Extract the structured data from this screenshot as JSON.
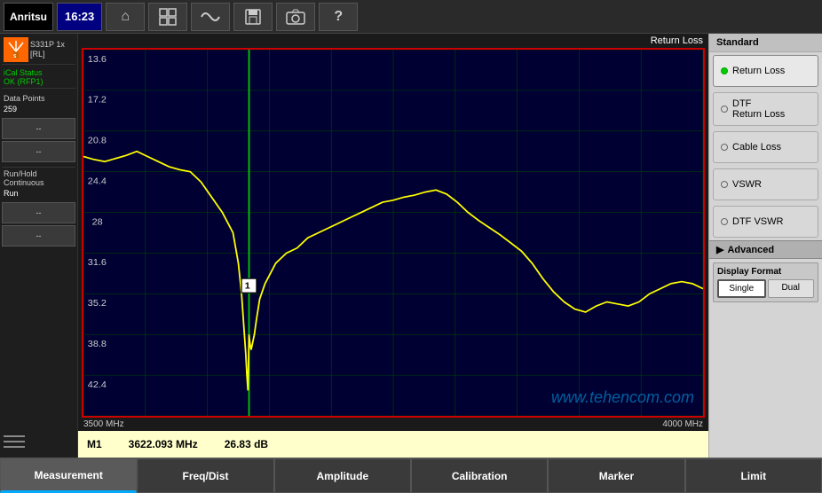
{
  "header": {
    "logo": "Anritsu",
    "time": "16:23",
    "icons": [
      {
        "name": "home-icon",
        "symbol": "⌂"
      },
      {
        "name": "grid-icon",
        "symbol": "▦"
      },
      {
        "name": "wave-icon",
        "symbol": "≋"
      },
      {
        "name": "save-icon",
        "symbol": "💾"
      },
      {
        "name": "camera-icon",
        "symbol": "📷"
      },
      {
        "name": "help-icon",
        "symbol": "?"
      }
    ]
  },
  "left_panel": {
    "device": "S331P 1x\n[RL]",
    "cal_status": "iCal Status\nOK (RFP1)",
    "data_points_label": "Data Points",
    "data_points_value": "259",
    "run_hold_label": "Run/Hold\nContinuous",
    "run_hold_value": "Run",
    "buttons": [
      "-- ",
      "-- ",
      "-- ",
      "-- "
    ]
  },
  "chart": {
    "title": "Return Loss",
    "freq_start": "3500 MHz",
    "freq_end": "4000 MHz",
    "y_labels": [
      "13.6",
      "17.2",
      "20.8",
      "24.4",
      "28",
      "31.6",
      "35.2",
      "38.8",
      "42.4"
    ],
    "marker_label": "M1",
    "marker_freq": "3622.093 MHz",
    "marker_value": "26.83 dB",
    "watermark": "www.tehencom.com"
  },
  "right_panel": {
    "title": "Standard",
    "menu_items": [
      {
        "label": "Return Loss",
        "active": true,
        "dot": "green"
      },
      {
        "label": "DTF\nReturn Loss",
        "active": false,
        "dot": "empty"
      },
      {
        "label": "Cable Loss",
        "active": false,
        "dot": "empty"
      },
      {
        "label": "VSWR",
        "active": false,
        "dot": "empty"
      },
      {
        "label": "DTF VSWR",
        "active": false,
        "dot": "empty"
      }
    ],
    "advanced_label": "Advanced",
    "display_format": {
      "label": "Display Format",
      "single": "Single",
      "dual": "Dual"
    }
  },
  "bottom_nav": {
    "tabs": [
      "Measurement",
      "Freq/Dist",
      "Amplitude",
      "Calibration",
      "Marker",
      "Limit"
    ]
  }
}
